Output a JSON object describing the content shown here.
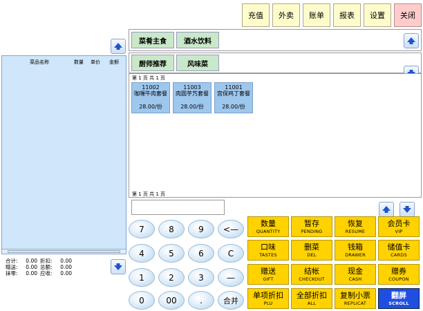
{
  "toolbar": {
    "recharge": "充值",
    "takeout": "外卖",
    "bill": "账单",
    "report": "报表",
    "settings": "设置",
    "close": "关闭"
  },
  "order": {
    "headers": [
      "菜品名称",
      "数量",
      "单价",
      "金额"
    ],
    "totals": [
      [
        {
          "label": "合计:",
          "value": "0.00"
        },
        {
          "label": "折扣:",
          "value": "0.00"
        }
      ],
      [
        {
          "label": "赠送:",
          "value": "0.00"
        },
        {
          "label": "总额:",
          "value": "0.00"
        }
      ],
      [
        {
          "label": "抹零:",
          "value": "0.00"
        },
        {
          "label": "应收:",
          "value": "0.00"
        }
      ]
    ]
  },
  "categories": {
    "row1": [
      "菜肴主食",
      "酒水饮料"
    ],
    "row2": [
      "厨师推荐",
      "风味菜"
    ]
  },
  "pager": {
    "top": "第 1 页  共 1 页",
    "bottom": "第 1 页  共 1 页"
  },
  "items": [
    {
      "code": "11002",
      "name": "咖喱牛肉套餐",
      "price": "28.00/份"
    },
    {
      "code": "11003",
      "name": "肉圆芋艿套餐",
      "price": "28.00/份"
    },
    {
      "code": "11001",
      "name": "宫保鸡丁套餐",
      "price": "28.00/份"
    }
  ],
  "keypad": {
    "k7": "7",
    "k8": "8",
    "k9": "9",
    "back": "<—",
    "k4": "4",
    "k5": "5",
    "k6": "6",
    "clear": "C",
    "k1": "1",
    "k2": "2",
    "k3": "3",
    "minus": "—",
    "k0": "0",
    "k00": "00",
    "dot": ".",
    "merge": "合并"
  },
  "functions": [
    {
      "zh": "数量",
      "en": "QUANTITY"
    },
    {
      "zh": "暂存",
      "en": "PENDING"
    },
    {
      "zh": "恢复",
      "en": "RESUME"
    },
    {
      "zh": "会员卡",
      "en": "VIP"
    },
    {
      "zh": "口味",
      "en": "TASTES"
    },
    {
      "zh": "删菜",
      "en": "DEL"
    },
    {
      "zh": "钱箱",
      "en": "DRAWER"
    },
    {
      "zh": "储值卡",
      "en": "CARDS"
    },
    {
      "zh": "赠送",
      "en": "GIFT"
    },
    {
      "zh": "结帐",
      "en": "CHECKOUT"
    },
    {
      "zh": "现金",
      "en": "CASH"
    },
    {
      "zh": "赠券",
      "en": "COUPON"
    },
    {
      "zh": "单项折扣",
      "en": "PLU"
    },
    {
      "zh": "全部折扣",
      "en": "ALL"
    },
    {
      "zh": "复制小票",
      "en": "REPLICAT"
    },
    {
      "zh": "翻屏",
      "en": "SCROLL"
    }
  ]
}
